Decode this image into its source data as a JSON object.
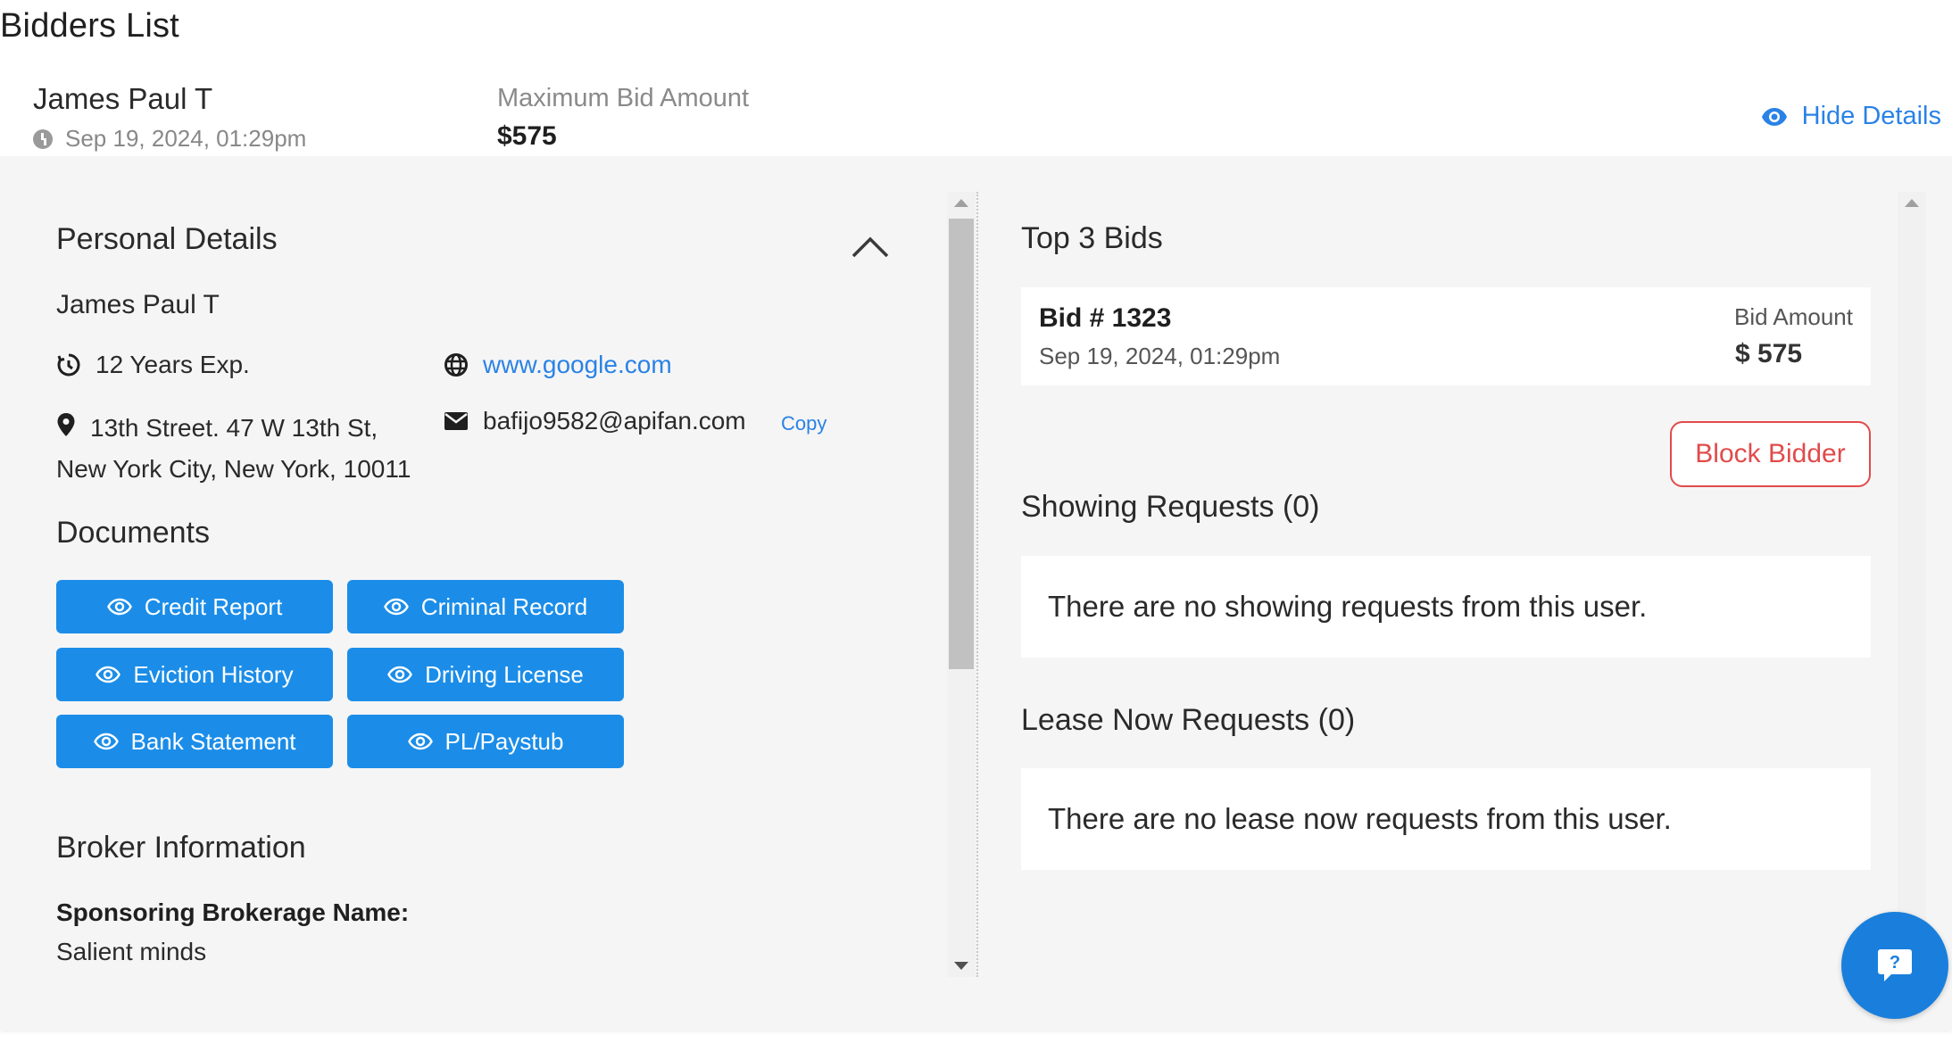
{
  "page": {
    "title": "Bidders List"
  },
  "bidder": {
    "name": "James Paul T",
    "time": "Sep 19, 2024, 01:29pm",
    "max_bid_label": "Maximum Bid Amount",
    "max_bid_value": "$575",
    "hide_details_label": "Hide Details"
  },
  "personal": {
    "heading": "Personal Details",
    "name": "James Paul T",
    "experience": "12 Years Exp.",
    "website": "www.google.com",
    "address": "13th Street. 47 W 13th St, New York City, New York, 10011",
    "email": "bafijo9582@apifan.com",
    "copy_label": "Copy"
  },
  "documents": {
    "heading": "Documents",
    "buttons": [
      "Credit Report",
      "Criminal Record",
      "Eviction History",
      "Driving License",
      "Bank Statement",
      "PL/Paystub"
    ]
  },
  "broker": {
    "heading": "Broker Information",
    "sponsor_label": "Sponsoring Brokerage Name:",
    "sponsor_value": "Salient minds"
  },
  "top_bids": {
    "heading": "Top 3 Bids",
    "bids": [
      {
        "number": "Bid # 1323",
        "date": "Sep 19, 2024, 01:29pm",
        "amount_label": "Bid Amount",
        "amount": "$ 575"
      }
    ]
  },
  "block_bidder_label": "Block Bidder",
  "showing_requests": {
    "heading": "Showing Requests (0)",
    "empty": "There are no showing requests from this user."
  },
  "lease_now_requests": {
    "heading": "Lease Now Requests (0)",
    "empty": "There are no lease now requests from this user."
  },
  "colors": {
    "accent": "#1b8de8",
    "link": "#2a82e6",
    "danger": "#e14b4b",
    "panel_bg": "#f5f5f5"
  },
  "icons": [
    "clock-icon",
    "eye-icon",
    "chevron-up-icon",
    "timer-icon",
    "globe-icon",
    "map-pin-icon",
    "mail-icon",
    "help-icon"
  ]
}
